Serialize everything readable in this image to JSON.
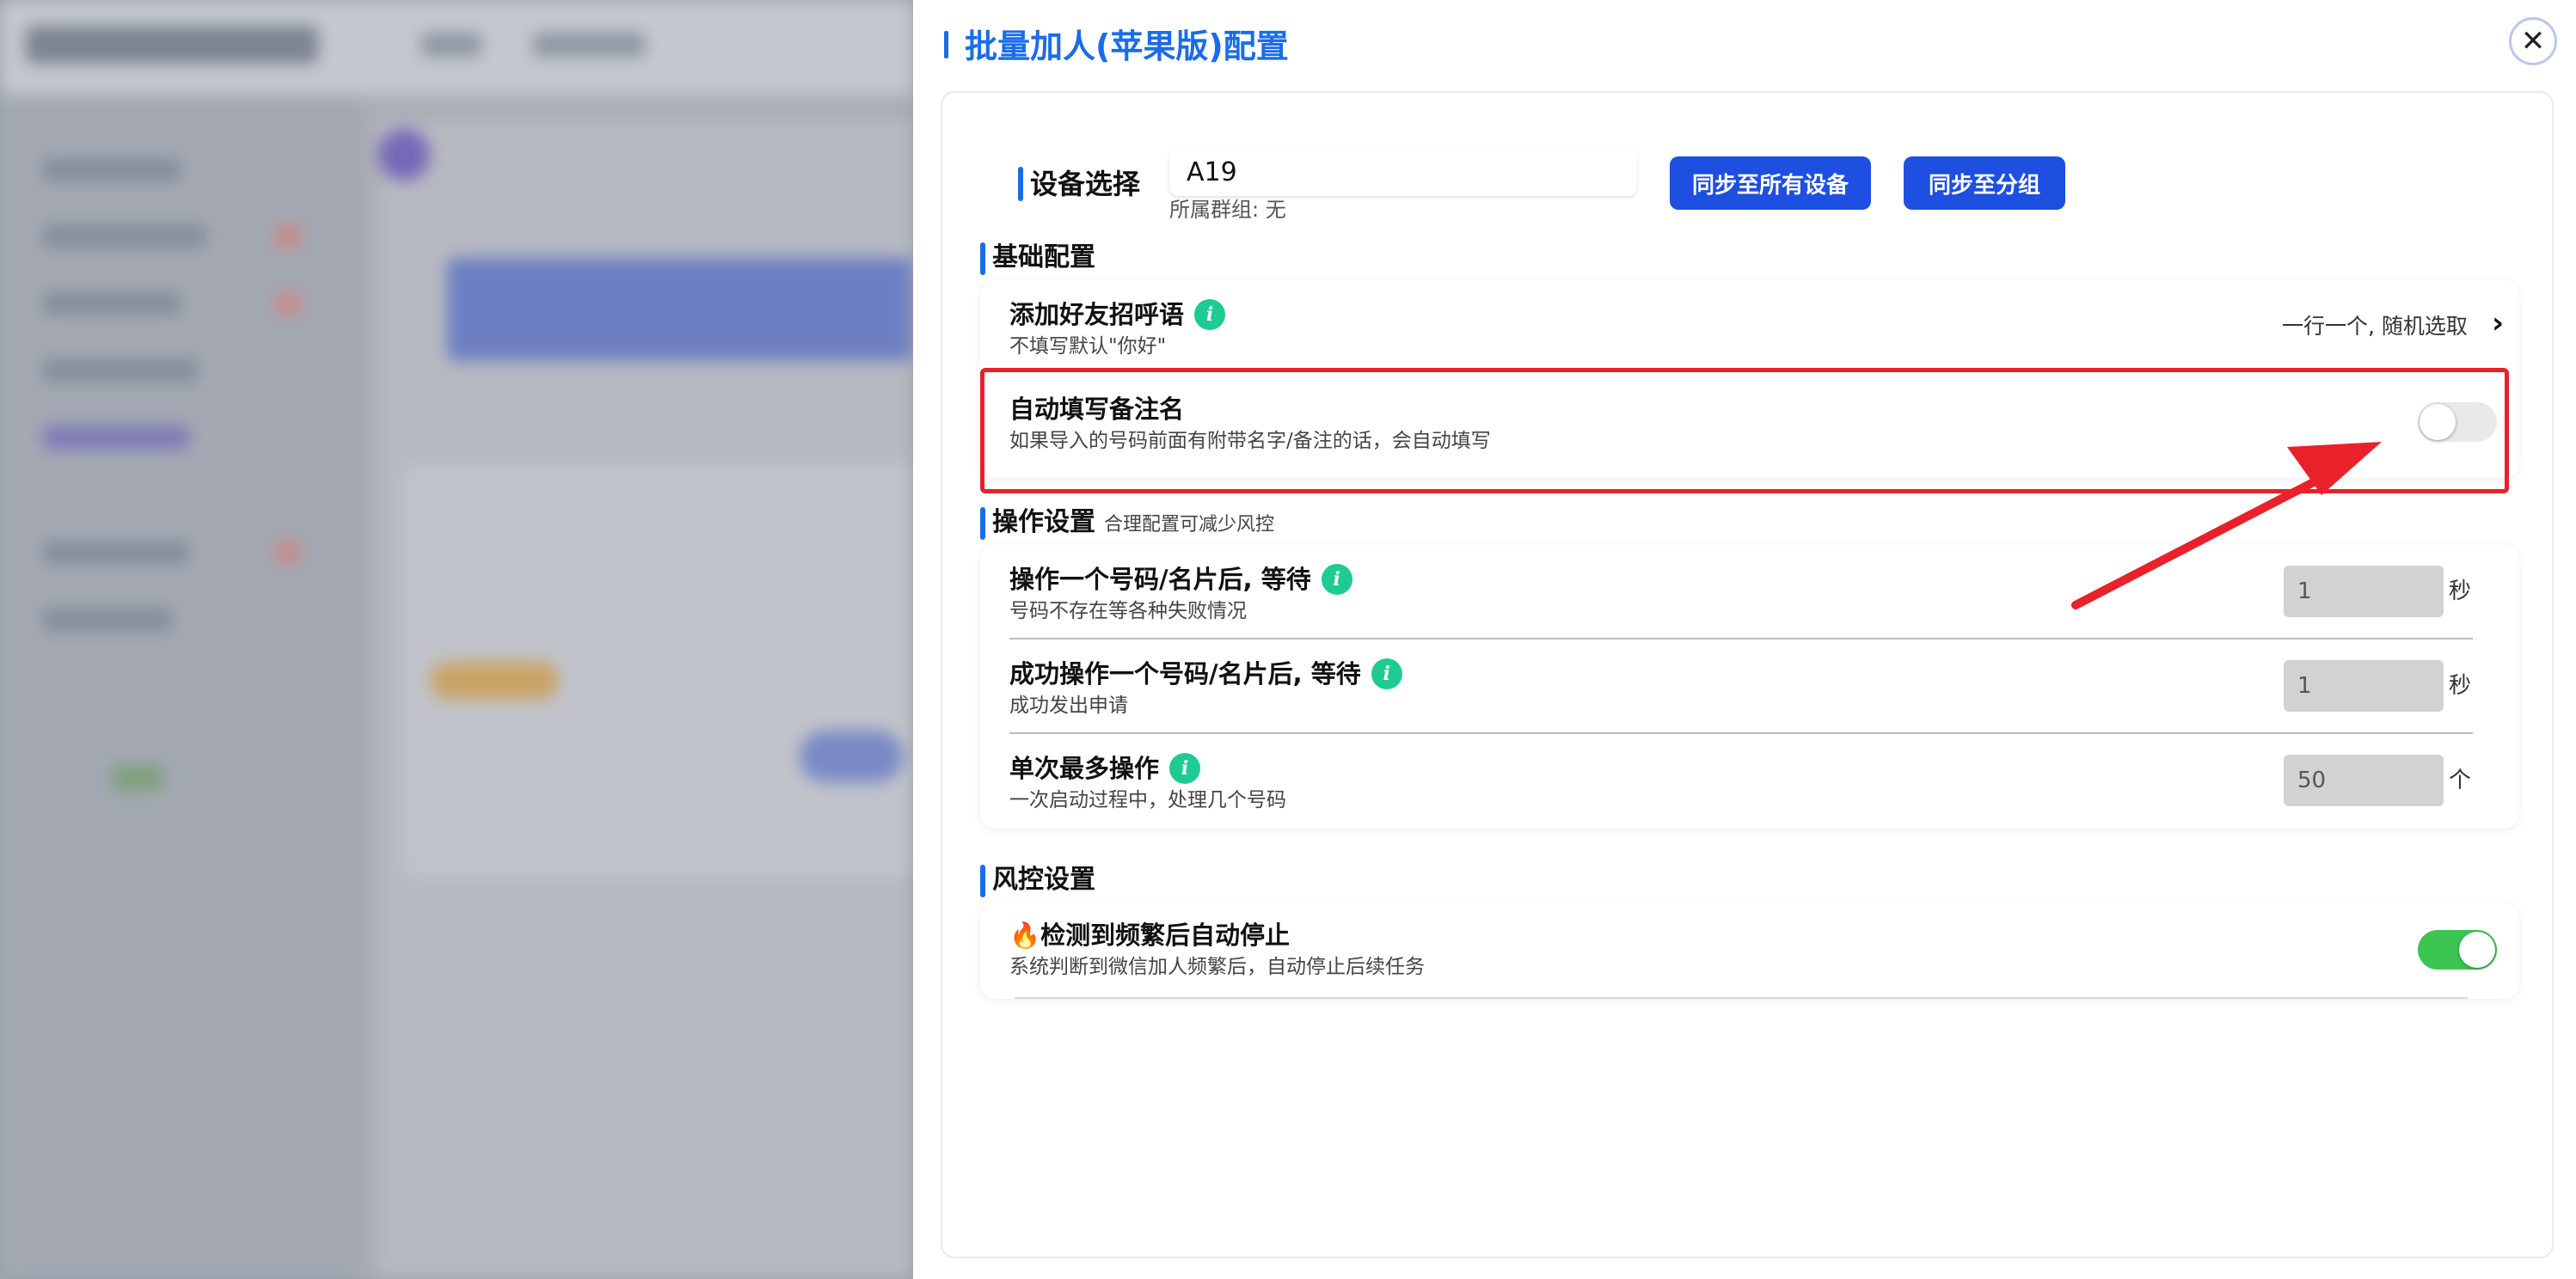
{
  "panel": {
    "title": "批量加人(苹果版)配置",
    "close_symbol": "✕"
  },
  "device": {
    "label": "设备选择",
    "value": "A19",
    "group_text": "所属群组: 无",
    "sync_all_label": "同步至所有设备",
    "sync_group_label": "同步至分组"
  },
  "basic": {
    "title": "基础配置",
    "greeting": {
      "title": "添加好友招呼语",
      "desc": "不填写默认\"你好\"",
      "right_text": "一行一个, 随机选取",
      "chevron": "›"
    },
    "auto_remark": {
      "title": "自动填写备注名",
      "desc": "如果导入的号码前面有附带名字/备注的话，会自动填写",
      "enabled": false
    }
  },
  "operation": {
    "title": "操作设置",
    "subtitle": "合理配置可减少风控",
    "rows": [
      {
        "title": "操作一个号码/名片后, 等待",
        "desc": "号码不存在等各种失败情况",
        "value": "1",
        "unit": "秒"
      },
      {
        "title": "成功操作一个号码/名片后, 等待",
        "desc": "成功发出申请",
        "value": "1",
        "unit": "秒"
      },
      {
        "title": "单次最多操作",
        "desc": "一次启动过程中，处理几个号码",
        "value": "50",
        "unit": "个"
      }
    ]
  },
  "risk": {
    "title": "风控设置",
    "auto_stop": {
      "title": "🔥检测到频繁后自动停止",
      "desc": "系统判断到微信加人频繁后，自动停止后续任务",
      "enabled": true
    }
  },
  "icons": {
    "info": "i"
  },
  "colors": {
    "accent": "#1b6ce8",
    "button": "#1d4fe0",
    "info": "#1ecb93",
    "toggle_on": "#3cc553",
    "highlight": "#e8212a"
  }
}
